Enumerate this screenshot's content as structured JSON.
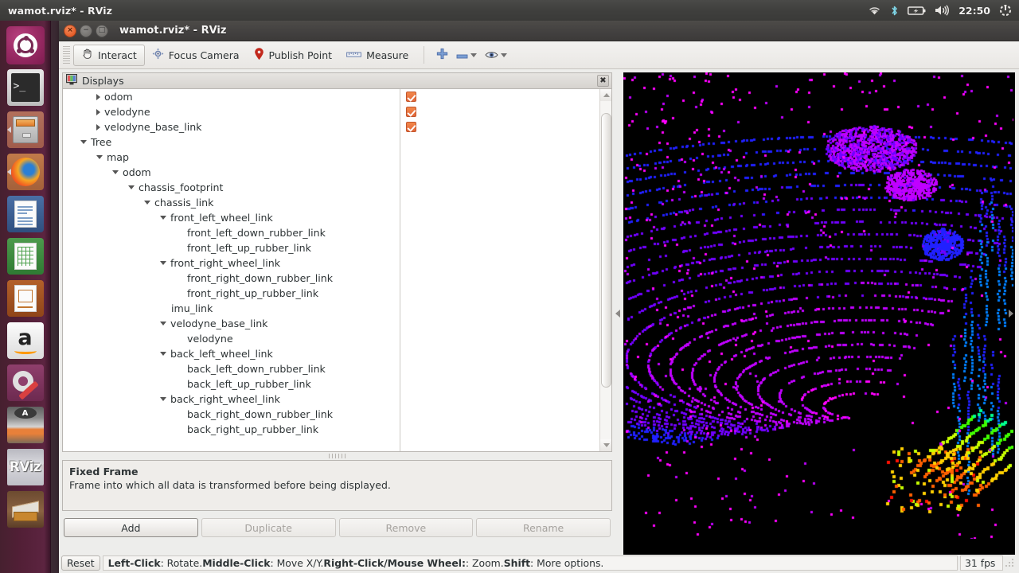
{
  "desktop": {
    "top_panel": {
      "title": "wamot.rviz* - RViz",
      "clock": "22:50",
      "indicators": [
        {
          "name": "wifi-icon",
          "label": "wifi"
        },
        {
          "name": "bluetooth-icon",
          "label": "bluetooth"
        },
        {
          "name": "battery-icon",
          "label": "battery"
        },
        {
          "name": "volume-icon",
          "label": "volume"
        },
        {
          "name": "system-menu-icon",
          "label": "system"
        }
      ]
    },
    "launcher": {
      "items": [
        {
          "name": "launcher-ubuntu-dash",
          "label": "Dash Home",
          "active": false
        },
        {
          "name": "launcher-terminal",
          "label": "Terminal",
          "active": false
        },
        {
          "name": "launcher-files",
          "label": "Files",
          "active": false
        },
        {
          "name": "launcher-firefox",
          "label": "Firefox Web Browser",
          "active": false
        },
        {
          "name": "launcher-libreoffice-writer",
          "label": "LibreOffice Writer",
          "active": false
        },
        {
          "name": "launcher-libreoffice-calc",
          "label": "LibreOffice Calc",
          "active": false
        },
        {
          "name": "launcher-libreoffice-impress",
          "label": "LibreOffice Impress",
          "active": false
        },
        {
          "name": "launcher-amazon",
          "label": "Amazon",
          "active": false
        },
        {
          "name": "launcher-system-settings",
          "label": "System Settings",
          "active": false
        },
        {
          "name": "launcher-software-updater",
          "label": "Software Updater",
          "active": false
        },
        {
          "name": "launcher-rviz",
          "label": "RViz",
          "active": true
        },
        {
          "name": "launcher-archive",
          "label": "Archive Manager",
          "active": false
        }
      ]
    }
  },
  "window": {
    "title": "wamot.rviz* - RViz",
    "controls": {
      "close": "×",
      "minimize": "−",
      "maximize": "□"
    }
  },
  "toolbar": {
    "items": [
      {
        "label": "Interact",
        "icon": "hand-cursor-icon",
        "active": true
      },
      {
        "label": "Focus Camera",
        "icon": "focus-camera-icon",
        "active": false
      },
      {
        "label": "Publish Point",
        "icon": "map-pin-icon",
        "active": false
      },
      {
        "label": "Measure",
        "icon": "ruler-icon",
        "active": false
      }
    ],
    "extra": [
      {
        "name": "add-tool-icon",
        "icon": "plus-icon",
        "has_caret": false
      },
      {
        "name": "remove-tool-icon",
        "icon": "minus-icon",
        "has_caret": true
      },
      {
        "name": "visibility-icon",
        "icon": "eye-icon",
        "has_caret": true
      }
    ]
  },
  "displays": {
    "header_title": "Displays",
    "close_label": "✖",
    "tree": [
      {
        "label": "odom",
        "depth": 1,
        "arrow": "collapsed",
        "checked": true
      },
      {
        "label": "velodyne",
        "depth": 1,
        "arrow": "collapsed",
        "checked": true
      },
      {
        "label": "velodyne_base_link",
        "depth": 1,
        "arrow": "collapsed",
        "checked": true
      },
      {
        "label": "Tree",
        "depth": 0,
        "arrow": "expanded",
        "checked": false
      },
      {
        "label": "map",
        "depth": 1,
        "arrow": "expanded",
        "checked": false
      },
      {
        "label": "odom",
        "depth": 2,
        "arrow": "expanded",
        "checked": false
      },
      {
        "label": "chassis_footprint",
        "depth": 3,
        "arrow": "expanded",
        "checked": false
      },
      {
        "label": "chassis_link",
        "depth": 4,
        "arrow": "expanded",
        "checked": false
      },
      {
        "label": "front_left_wheel_link",
        "depth": 5,
        "arrow": "expanded",
        "checked": false
      },
      {
        "label": "front_left_down_rubber_link",
        "depth": 6,
        "arrow": "none",
        "checked": false
      },
      {
        "label": "front_left_up_rubber_link",
        "depth": 6,
        "arrow": "none",
        "checked": false
      },
      {
        "label": "front_right_wheel_link",
        "depth": 5,
        "arrow": "expanded",
        "checked": false
      },
      {
        "label": "front_right_down_rubber_link",
        "depth": 6,
        "arrow": "none",
        "checked": false
      },
      {
        "label": "front_right_up_rubber_link",
        "depth": 6,
        "arrow": "none",
        "checked": false
      },
      {
        "label": "imu_link",
        "depth": 5,
        "arrow": "none",
        "checked": false
      },
      {
        "label": "velodyne_base_link",
        "depth": 5,
        "arrow": "expanded",
        "checked": false
      },
      {
        "label": "velodyne",
        "depth": 6,
        "arrow": "none",
        "checked": false
      },
      {
        "label": "back_left_wheel_link",
        "depth": 5,
        "arrow": "expanded",
        "checked": false
      },
      {
        "label": "back_left_down_rubber_link",
        "depth": 6,
        "arrow": "none",
        "checked": false
      },
      {
        "label": "back_left_up_rubber_link",
        "depth": 6,
        "arrow": "none",
        "checked": false
      },
      {
        "label": "back_right_wheel_link",
        "depth": 5,
        "arrow": "expanded",
        "checked": false
      },
      {
        "label": "back_right_down_rubber_link",
        "depth": 6,
        "arrow": "none",
        "checked": false
      },
      {
        "label": "back_right_up_rubber_link",
        "depth": 6,
        "arrow": "none",
        "checked": false
      }
    ]
  },
  "description": {
    "title": "Fixed Frame",
    "body": "Frame into which all data is transformed before being displayed."
  },
  "buttons": [
    {
      "label": "Add",
      "enabled": true
    },
    {
      "label": "Duplicate",
      "enabled": false
    },
    {
      "label": "Remove",
      "enabled": false
    },
    {
      "label": "Rename",
      "enabled": false
    }
  ],
  "statusbar": {
    "reset_label": "Reset",
    "hint_parts": [
      {
        "text": "Left-Click",
        "bold": true
      },
      {
        "text": ": Rotate. ",
        "bold": false
      },
      {
        "text": "Middle-Click",
        "bold": true
      },
      {
        "text": ": Move X/Y. ",
        "bold": false
      },
      {
        "text": "Right-Click/Mouse Wheel:",
        "bold": true
      },
      {
        "text": ": Zoom. ",
        "bold": false
      },
      {
        "text": "Shift",
        "bold": true
      },
      {
        "text": ": More options.",
        "bold": false
      }
    ],
    "fps": "31 fps"
  },
  "view3d": {
    "background": "#000000",
    "point_colors": [
      "#ff00ff",
      "#c000ff",
      "#7000ff",
      "#2020ff",
      "#0080ff",
      "#00d0ff",
      "#00ff90",
      "#40ff00",
      "#c8ff00",
      "#ffd000",
      "#ff6000",
      "#ff1000"
    ]
  }
}
